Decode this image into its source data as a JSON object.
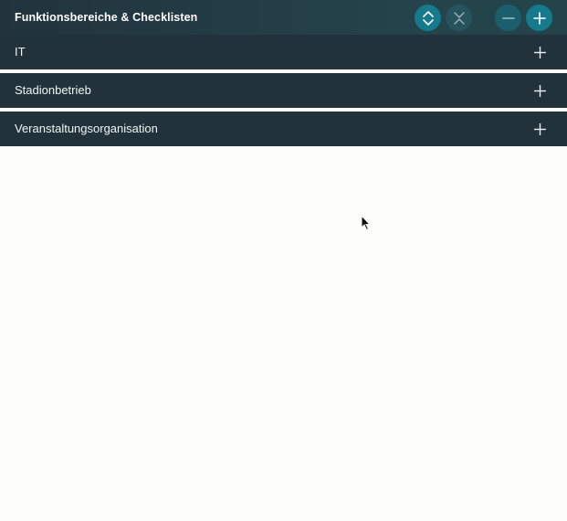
{
  "header": {
    "title": "Funktionsbereiche & Checklisten",
    "buttons": {
      "expand_all": {
        "icon": "chevron-up-down-icon",
        "color": "#157a8c"
      },
      "collapse_all": {
        "icon": "collapse-x-icon",
        "color": "#25545f"
      },
      "zoom_out": {
        "icon": "minus-icon",
        "color": "#1b5f6c"
      },
      "zoom_in": {
        "icon": "plus-icon",
        "color": "#157a8c"
      }
    }
  },
  "sections": [
    {
      "label": "IT",
      "icon": "plus-icon"
    },
    {
      "label": "Stadionbetrieb",
      "icon": "plus-icon"
    },
    {
      "label": "Veranstaltungsorganisation",
      "icon": "plus-icon"
    }
  ],
  "colors": {
    "header_bg": "#23414a",
    "section_bg": "#22323b",
    "page_bg": "#fdfdfc",
    "accent": "#157a8c"
  }
}
